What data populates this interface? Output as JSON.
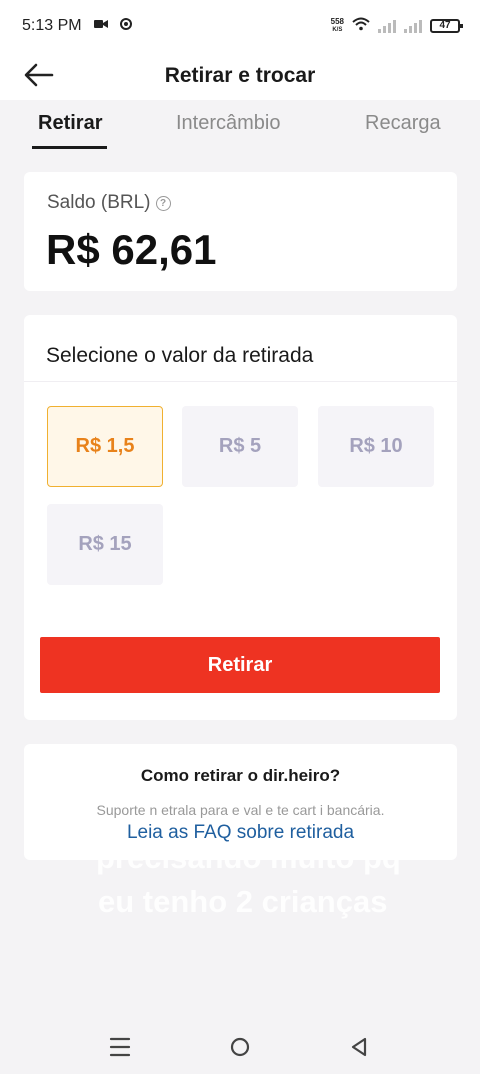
{
  "status_bar": {
    "time": "5:13 PM",
    "net_speed_value": "558",
    "net_speed_unit": "K/S",
    "battery": "47"
  },
  "header": {
    "title": "Retirar e trocar"
  },
  "tabs": [
    {
      "label": "Retirar",
      "active": true
    },
    {
      "label": "Intercâmbio",
      "active": false
    },
    {
      "label": "Recarga",
      "active": false
    }
  ],
  "balance": {
    "label": "Saldo (BRL)",
    "help_glyph": "?",
    "value": "R$ 62,61"
  },
  "withdraw": {
    "title": "Selecione o valor da retirada",
    "options": [
      {
        "label": "R$ 1,5",
        "selected": true
      },
      {
        "label": "R$ 5",
        "selected": false
      },
      {
        "label": "R$ 10",
        "selected": false
      },
      {
        "label": "R$ 15",
        "selected": false
      }
    ],
    "button_label": "Retirar"
  },
  "faq": {
    "title": "Como retirar o dir.heiro?",
    "subtitle": "Suporte n etrala para e val e te cart i bancária.",
    "link": "Leia as FAQ sobre retirada"
  },
  "overlay": {
    "line1": "precisando muito pq",
    "line2": "eu tenho 2 crianças"
  },
  "colors": {
    "accent_red": "#ee3322",
    "selected_orange": "#e8821a",
    "link_blue": "#1f5f9f"
  }
}
